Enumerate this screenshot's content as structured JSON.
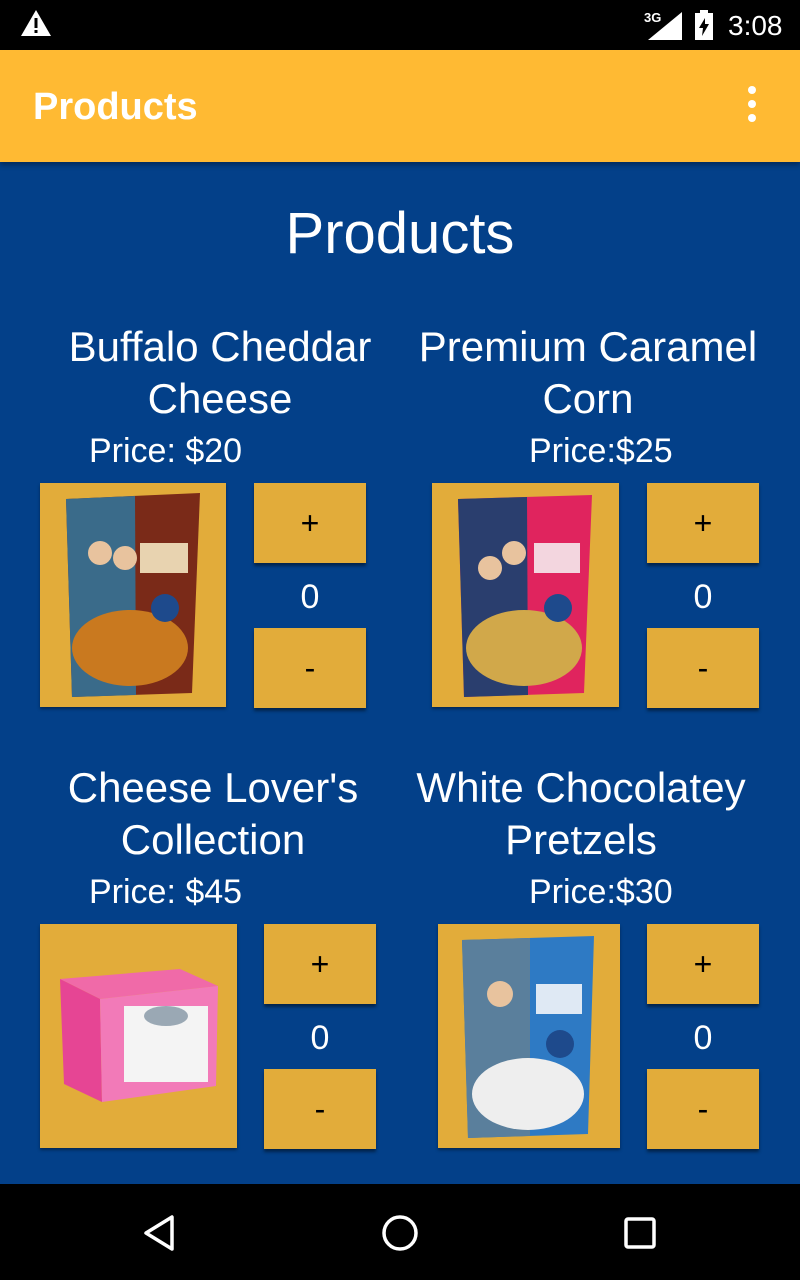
{
  "status_bar": {
    "network": "3G",
    "time": "3:08"
  },
  "app_bar": {
    "title": "Products"
  },
  "page": {
    "heading": "Products"
  },
  "products": [
    {
      "name_line1": "Buffalo Cheddar",
      "name_line2": "Cheese",
      "price": "Price: $20",
      "quantity": "0",
      "plus_label": "+",
      "minus_label": "-",
      "image": "buffalo-cheddar-bag"
    },
    {
      "name_line1": "Premium Caramel",
      "name_line2": "Corn",
      "price": "Price:$25",
      "quantity": "0",
      "plus_label": "+",
      "minus_label": "-",
      "image": "caramel-corn-bag"
    },
    {
      "name_line1": "Cheese Lover's",
      "name_line2": "Collection",
      "price": "Price: $45",
      "quantity": "0",
      "plus_label": "+",
      "minus_label": "-",
      "image": "cheese-lovers-box"
    },
    {
      "name_line1": "White Chocolatey",
      "name_line2": "Pretzels",
      "price": "Price:$30",
      "quantity": "0",
      "plus_label": "+",
      "minus_label": "-",
      "image": "pretzels-bag"
    }
  ],
  "colors": {
    "app_bar": "#FFBA33",
    "background": "#034089",
    "button": "#E2AC3A"
  }
}
